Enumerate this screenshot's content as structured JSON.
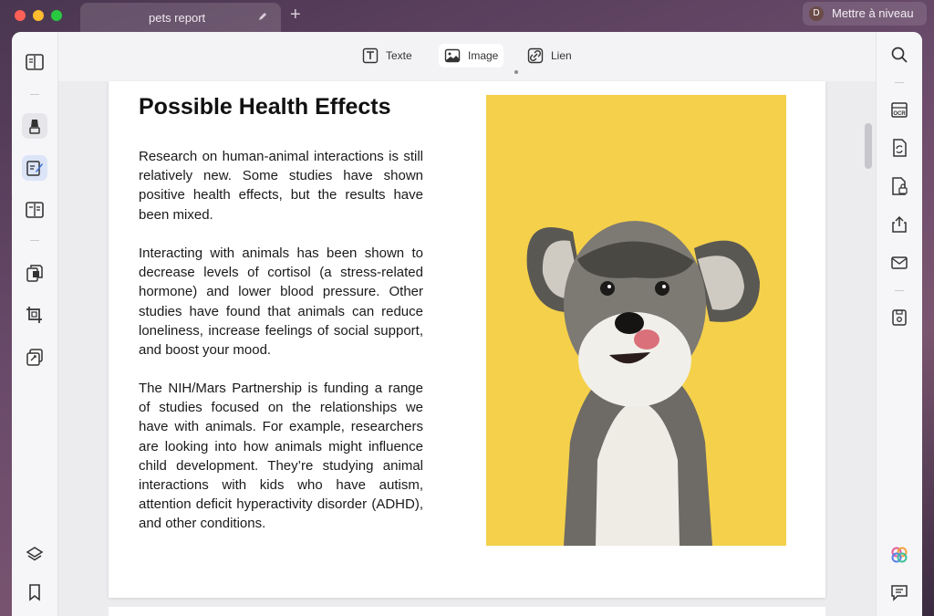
{
  "tab": {
    "title": "pets report"
  },
  "upgrade": {
    "avatar_initial": "D",
    "label": "Mettre à niveau"
  },
  "toolbar": {
    "tools": [
      {
        "label": "Texte",
        "icon": "text-icon"
      },
      {
        "label": "Image",
        "icon": "image-icon",
        "active": true
      },
      {
        "label": "Lien",
        "icon": "link-icon"
      }
    ]
  },
  "document": {
    "heading": "Possible Health Effects",
    "paragraphs": [
      "Research on human-animal interactions is still relatively new. Some studies have shown positive health effects, but the results have been mixed.",
      "Interacting with animals has been shown to decrease levels of cortisol (a stress-related hormone) and lower blood pressure. Other studies have found that animals can reduce loneliness, increase feelings of social support, and boost your mood.",
      "The NIH/Mars Partnership is funding a range of studies focused on the relationships we have with animals. For example, researchers are looking into how animals might influence child development. They’re studying animal interactions with kids who have autism, attention deficit hyperactivity disorder (ADHD), and other conditions."
    ],
    "image_description": "schnauzer-dog-photo"
  },
  "colors": {
    "accent": "#3d6fd8",
    "photo_background": "#f5d04a",
    "window_background": "#f3f3f5"
  },
  "icons": {
    "left_rail": [
      "reader-icon",
      "highlighter-icon",
      "edit-icon",
      "form-icon",
      "organize-pages-icon",
      "crop-icon",
      "convert-icon",
      "layers-icon",
      "bookmark-icon"
    ],
    "right_rail": [
      "search-icon",
      "ocr-icon",
      "convert-pdf-icon",
      "protect-icon",
      "share-icon",
      "mail-icon",
      "save-icon",
      "ai-assistant-icon",
      "comment-icon"
    ]
  }
}
